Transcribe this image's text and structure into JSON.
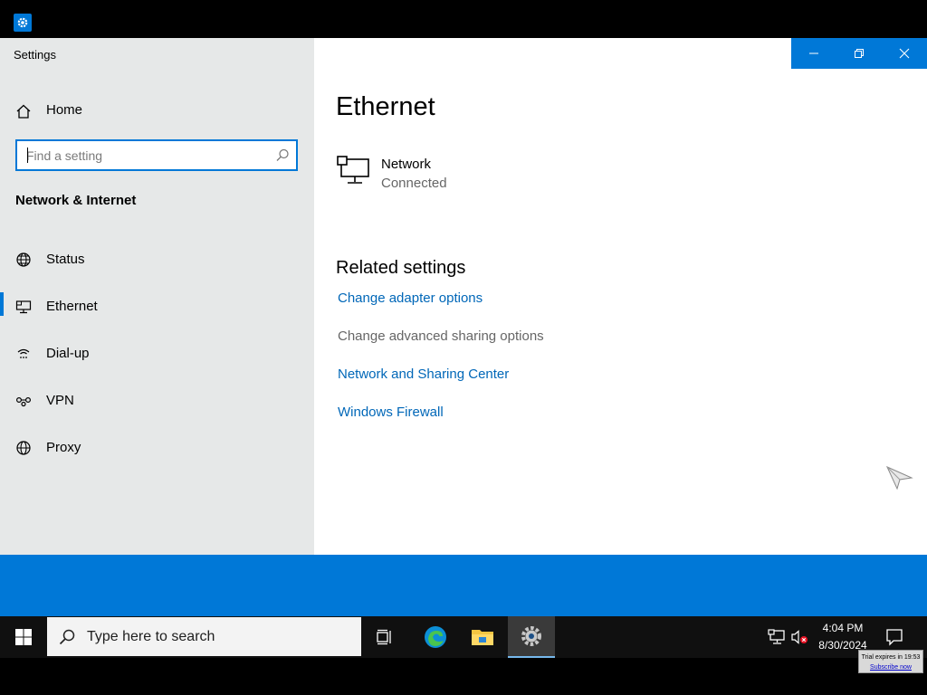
{
  "window": {
    "app_title": "Settings"
  },
  "sidebar": {
    "home_label": "Home",
    "search_placeholder": "Find a setting",
    "section_title": "Network & Internet",
    "items": [
      {
        "label": "Status",
        "icon": "globe-status-icon",
        "active": false
      },
      {
        "label": "Ethernet",
        "icon": "ethernet-icon",
        "active": true
      },
      {
        "label": "Dial-up",
        "icon": "dialup-icon",
        "active": false
      },
      {
        "label": "VPN",
        "icon": "vpn-icon",
        "active": false
      },
      {
        "label": "Proxy",
        "icon": "globe-icon",
        "active": false
      }
    ]
  },
  "content": {
    "title": "Ethernet",
    "network": {
      "name": "Network",
      "status": "Connected"
    },
    "related_title": "Related settings",
    "links": [
      {
        "label": "Change adapter options",
        "style": "link"
      },
      {
        "label": "Change advanced sharing options",
        "style": "gray"
      },
      {
        "label": "Network and Sharing Center",
        "style": "link"
      },
      {
        "label": "Windows Firewall",
        "style": "link"
      }
    ]
  },
  "taskbar": {
    "search_placeholder": "Type here to search",
    "time": "4:04 PM",
    "date": "8/30/2024",
    "trial_text": "Trial expires in 19:53",
    "trial_link": "Subscribe now"
  },
  "colors": {
    "accent": "#0078d7",
    "link": "#0067b8",
    "sidebar_bg": "#e6e8e8",
    "taskbar_bg": "#101010"
  }
}
